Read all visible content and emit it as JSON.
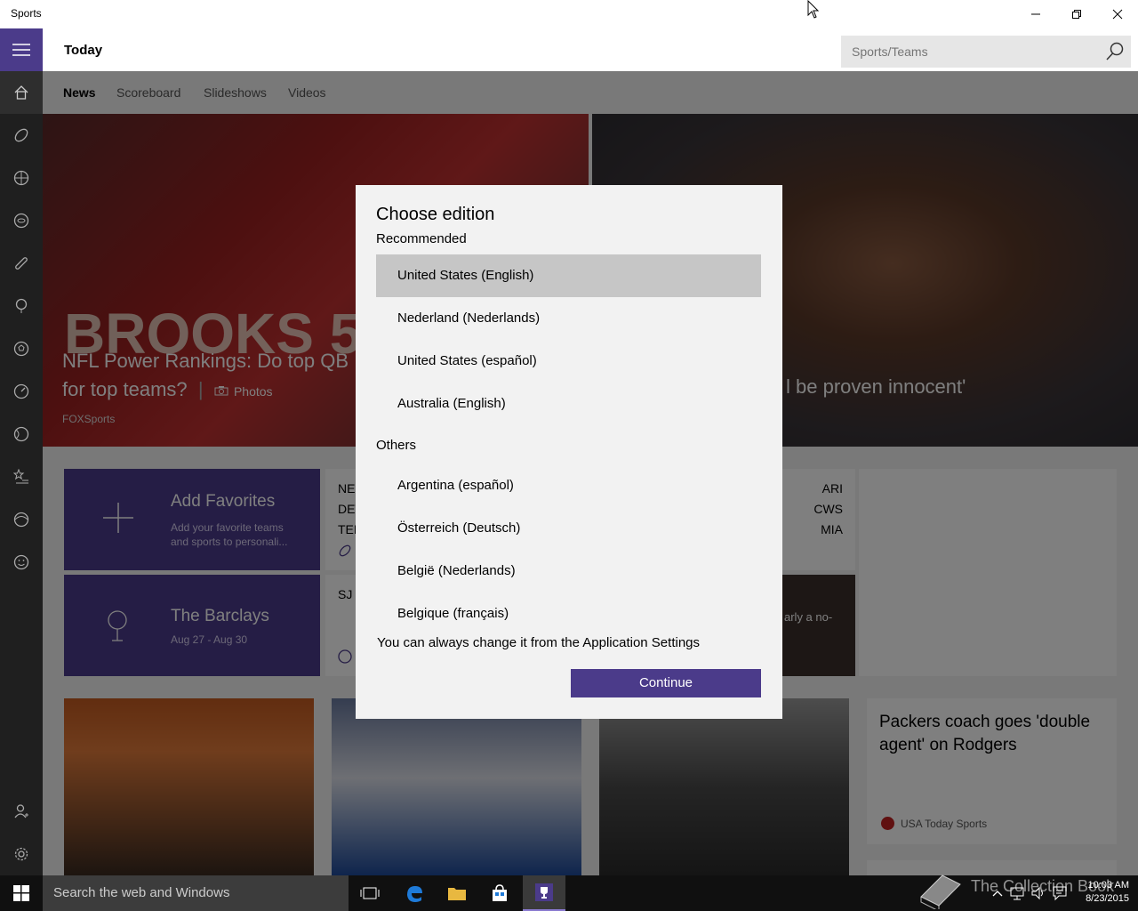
{
  "window": {
    "title": "Sports"
  },
  "header": {
    "page_title": "Today",
    "search_placeholder": "Sports/Teams"
  },
  "tabs": [
    {
      "label": "News"
    },
    {
      "label": "Scoreboard"
    },
    {
      "label": "Slideshows"
    },
    {
      "label": "Videos"
    }
  ],
  "hero": {
    "left": {
      "headline": "NFL Power Rankings: Do top QB",
      "headline2": "for top teams?",
      "media_label": "Photos",
      "source": "FOXSports",
      "jersey": "BROOKS 55"
    },
    "right": {
      "headline": "l be proven innocent'"
    }
  },
  "tiles": {
    "favorites": {
      "title": "Add Favorites",
      "subtitle": "Add your favorite teams and sports to personali..."
    },
    "barclays": {
      "title": "The Barclays",
      "dates": "Aug 27 - Aug 30"
    },
    "score_left": [
      "NE",
      "DET",
      "TEN"
    ],
    "score_right": [
      "ARI",
      "CWS",
      "MIA"
    ],
    "score2_left": "SJ",
    "score2_caption": "arly a no-"
  },
  "news_card": {
    "title": "Packers coach goes 'double agent' on Rodgers",
    "source": "USA Today Sports"
  },
  "dialog": {
    "title": "Choose edition",
    "recommended_label": "Recommended",
    "recommended": [
      "United States (English)",
      "Nederland (Nederlands)",
      "United States (español)",
      "Australia (English)"
    ],
    "others_label": "Others",
    "others": [
      "Argentina (español)",
      "Österreich (Deutsch)",
      "België (Nederlands)",
      "Belgique (français)"
    ],
    "selected": "United States (English)",
    "note": "You can always change it from the Application Settings",
    "continue_label": "Continue"
  },
  "taskbar": {
    "search_placeholder": "Search the web and Windows",
    "time": "10:03 AM",
    "date": "8/23/2015"
  },
  "watermark": "The Collection Book",
  "colors": {
    "accent": "#4b3b8a",
    "rail": "#1f1f1f",
    "taskbar": "#101010"
  }
}
